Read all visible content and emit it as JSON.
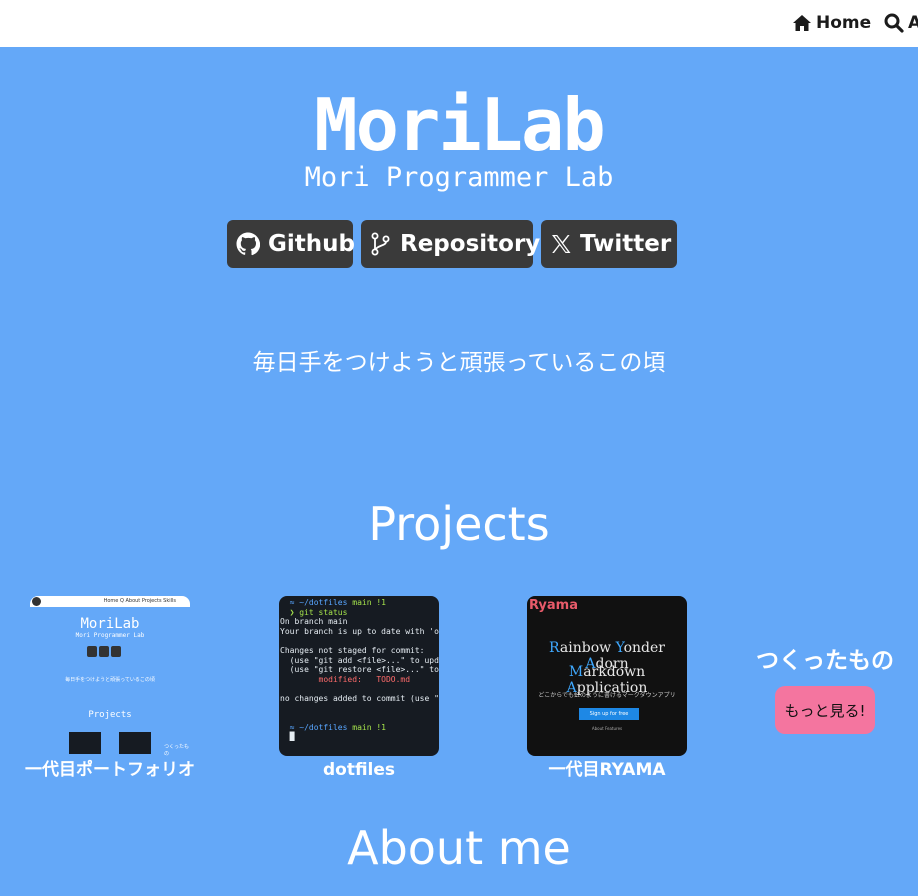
{
  "nav": {
    "home_label": "Home",
    "search_label": "A"
  },
  "hero": {
    "title": "MoriLab",
    "subtitle": "Mori Programmer Lab",
    "buttons": {
      "github": "Github",
      "repository": "Repository",
      "twitter": "Twitter"
    },
    "tagline": "毎日手をつけようと頑張っているこの頃"
  },
  "projects": {
    "title": "Projects",
    "items": [
      {
        "label": "一代目ポートフォリオ"
      },
      {
        "label": "dotfiles"
      },
      {
        "label": "一代目RYAMA"
      }
    ],
    "more": {
      "title": "つくったもの",
      "button": "もっと見る!"
    },
    "thumb1": {
      "nav": "Home  Q About  Projects  Skills",
      "title": "MoriLab",
      "subtitle": "Mori Programmer Lab",
      "tagline": "毎日手をつけようと頑張っているこの頃",
      "projects": "Projects",
      "more": "つくったもの"
    },
    "thumb2": {
      "prompt_dir": "~/dotfiles",
      "branch": "main !1",
      "cmd": "git status",
      "l1": "On branch main",
      "l2": "Your branch is up to date with 'ori",
      "l3": "Changes not staged for commit:",
      "l4": "  (use \"git add <file>...\" to updat",
      "l5": "  (use \"git restore <file>...\" to d",
      "l6": "        modified:   TODO.md",
      "l7": "no changes added to commit (use \"gi"
    },
    "thumb3": {
      "logo": "Ryama",
      "line1_a": "R",
      "line1_b": "ainbow ",
      "line1_c": "Y",
      "line1_d": "onder ",
      "line1_e": "A",
      "line1_f": "dorn",
      "line2_a": "M",
      "line2_b": "arkdown ",
      "line2_c": "A",
      "line2_d": "pplication",
      "desc": "どこからでも虹のように書けるマークダウンアプリ",
      "signup": "Sign up for free",
      "links": "About   Features"
    }
  },
  "about": {
    "title": "About me"
  },
  "colors": {
    "background": "#64a8f8",
    "button_dark": "#3a3a3a",
    "more_button": "#f4759f"
  }
}
